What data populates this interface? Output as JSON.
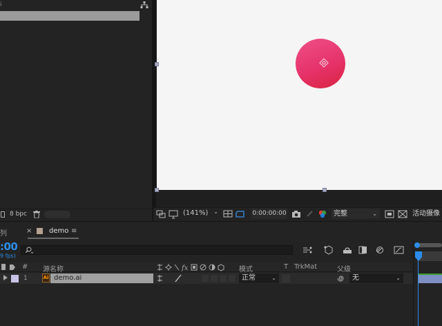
{
  "project_panel": {
    "corner_label": "i",
    "footer": {
      "bpc_label": "8 bpc"
    }
  },
  "viewer_toolbar": {
    "zoom": "(141%)",
    "timecode": "0:00:00:00",
    "resolution": "完整",
    "camera_view": "活动摄像"
  },
  "timeline": {
    "prev_tab_label": "列",
    "close_glyph": "×",
    "comp_tab_label": "demo",
    "tab_menu_glyph": "≡",
    "current_time": ":00",
    "fps": "9 fps)",
    "columns": {
      "hash": "#",
      "source_name": "源名称",
      "mode": "模式",
      "t": "T",
      "trkmat": "TrkMat",
      "parent": "父级"
    },
    "layers": [
      {
        "index": "1",
        "name": "demo.ai",
        "mode": "正常",
        "parent": "无"
      }
    ],
    "file_icon_text": "Ai"
  },
  "colors": {
    "accent_blue": "#2d8ceb",
    "layer_label": "#c7c3e6",
    "comp_swatch": "#b2a293",
    "circle_top": "#ef4f88",
    "circle_bottom": "#d9233f",
    "layer_bar": "#7e8fc4"
  },
  "icons": [
    "hierarchy-icon",
    "trash-icon",
    "anchor-point-icon",
    "region-icon",
    "monitor-icon",
    "grid-icon",
    "mask-toggle-icon",
    "camera-snapshot-icon",
    "color-channels-icon",
    "search-icon",
    "comp-flowchart-icon",
    "draft-3d-icon",
    "shy-layers-icon",
    "frame-blending-icon",
    "motion-blur-icon",
    "graph-editor-icon",
    "pickwhip-icon"
  ]
}
